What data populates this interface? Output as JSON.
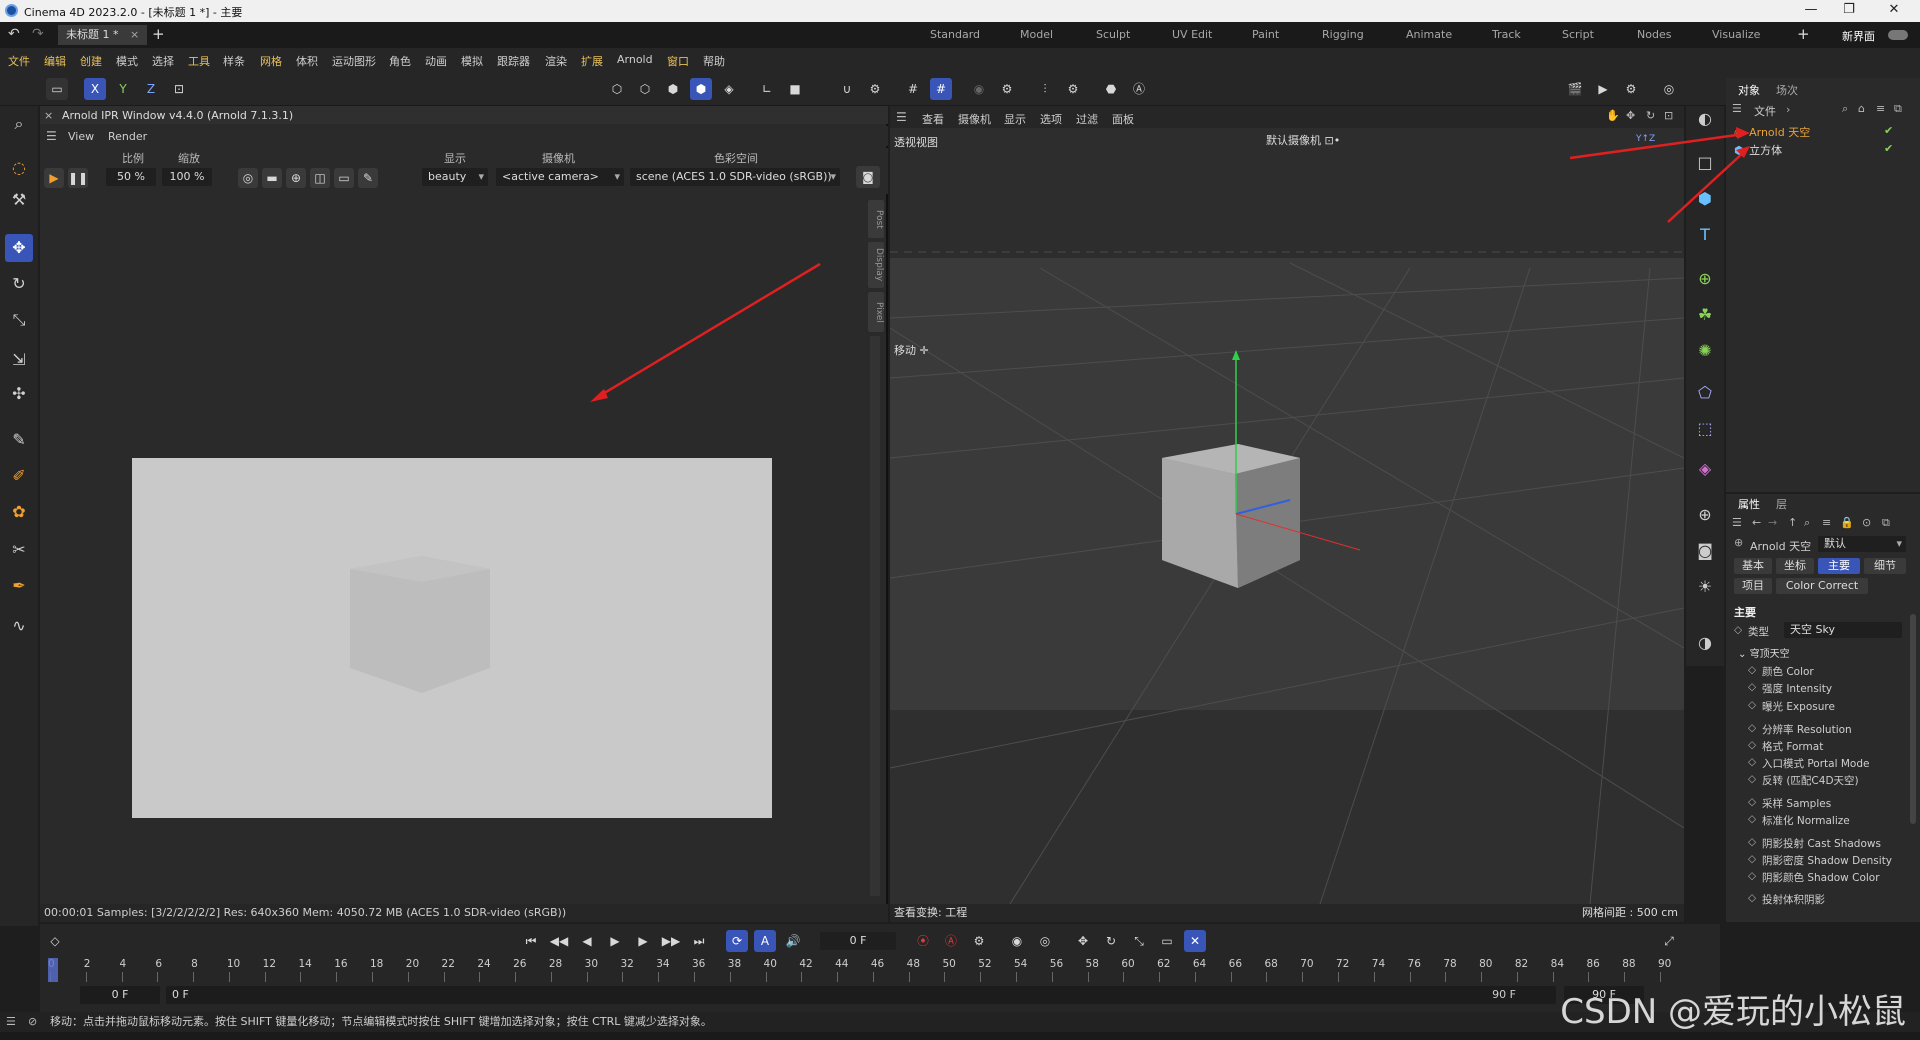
{
  "window": {
    "title": "Cinema 4D 2023.2.0 - [未标题 1 *] - 主要",
    "doc_tab": "未标题 1 *"
  },
  "layouts": [
    "Standard",
    "Model",
    "Sculpt",
    "UV Edit",
    "Paint",
    "Rigging",
    "Animate",
    "Track",
    "Script",
    "Nodes",
    "Visualize"
  ],
  "new_layout": "新界面",
  "menu": [
    "文件",
    "编辑",
    "创建",
    "模式",
    "选择",
    "工具",
    "样条",
    "网格",
    "体积",
    "运动图形",
    "角色",
    "动画",
    "模拟",
    "跟踪器",
    "渲染",
    "扩展",
    "Arnold",
    "窗口",
    "帮助"
  ],
  "axis": {
    "x": "X",
    "y": "Y",
    "z": "Z"
  },
  "ipr": {
    "title": "Arnold IPR Window v4.4.0 (Arnold 7.1.3.1)",
    "menu": {
      "view": "View",
      "render": "Render"
    },
    "labels": {
      "ratio": "比例",
      "zoom": "缩放",
      "display": "显示",
      "camera": "摄像机",
      "colorspace": "色彩空间"
    },
    "values": {
      "ratio": "50 %",
      "zoom": "100 %",
      "display": "beauty",
      "camera": "<active camera>",
      "colorspace": "scene (ACES 1.0 SDR-video (sRGB))"
    },
    "side_tabs": [
      "Post",
      "Display",
      "Pixel"
    ],
    "status": "00:00:01  Samples: [3/2/2/2/2/2]  Res: 640x360  Mem: 4050.72 MB  (ACES 1.0 SDR-video (sRGB))"
  },
  "viewport": {
    "menu": [
      "查看",
      "摄像机",
      "显示",
      "选项",
      "过滤",
      "面板"
    ],
    "label": "透视视图",
    "camera": "默认摄像机 ⊡•",
    "move_label": "移动 ✛",
    "status_left": "查看变换: 工程",
    "status_right": "网格间距 : 500 cm"
  },
  "objects": {
    "tabs": {
      "objects": "对象",
      "scene": "场次"
    },
    "file_menu": "文件",
    "file_chevron": "›",
    "items": [
      {
        "name": "Arnold 天空",
        "color": "#e8a23a"
      },
      {
        "name": "立方体",
        "color": "#dcdcdc"
      }
    ]
  },
  "attributes": {
    "tabs": {
      "attr": "属性",
      "layer": "层"
    },
    "object_name": "Arnold 天空",
    "preset": "默认",
    "buttons": [
      "基本",
      "坐标",
      "主要",
      "细节",
      "项目",
      "Color Correct"
    ],
    "active_button": "主要",
    "section": "主要",
    "type_label": "类型",
    "type_value": "天空 Sky",
    "group": "穹顶天空",
    "items": [
      "颜色 Color",
      "强度 Intensity",
      "曝光 Exposure",
      "分辨率 Resolution",
      "格式 Format",
      "入口模式 Portal Mode",
      "反转 (匹配C4D天空)",
      "采样 Samples",
      "标准化 Normalize",
      "阴影投射 Cast Shadows",
      "阴影密度 Shadow Density",
      "阴影颜色 Shadow Color",
      "投射体积阴影"
    ]
  },
  "timeline": {
    "ticks": [
      "0",
      "2",
      "4",
      "6",
      "8",
      "10",
      "12",
      "14",
      "16",
      "18",
      "20",
      "22",
      "24",
      "26",
      "28",
      "30",
      "32",
      "34",
      "36",
      "38",
      "40",
      "42",
      "44",
      "46",
      "48",
      "50",
      "52",
      "54",
      "56",
      "58",
      "60",
      "62",
      "64",
      "66",
      "68",
      "70",
      "72",
      "74",
      "76",
      "78",
      "80",
      "82",
      "84",
      "86",
      "88",
      "90"
    ],
    "current_frame": "0 F",
    "start": "0 F",
    "min": "0 F",
    "end": "90 F",
    "max": "90 F"
  },
  "statusbar": "移动：点击并拖动鼠标移动元素。按住 SHIFT 键量化移动；节点编辑模式时按住 SHIFT 键增加选择对象；按住 CTRL 键减少选择对象。",
  "watermark": "CSDN @爱玩的小松鼠"
}
